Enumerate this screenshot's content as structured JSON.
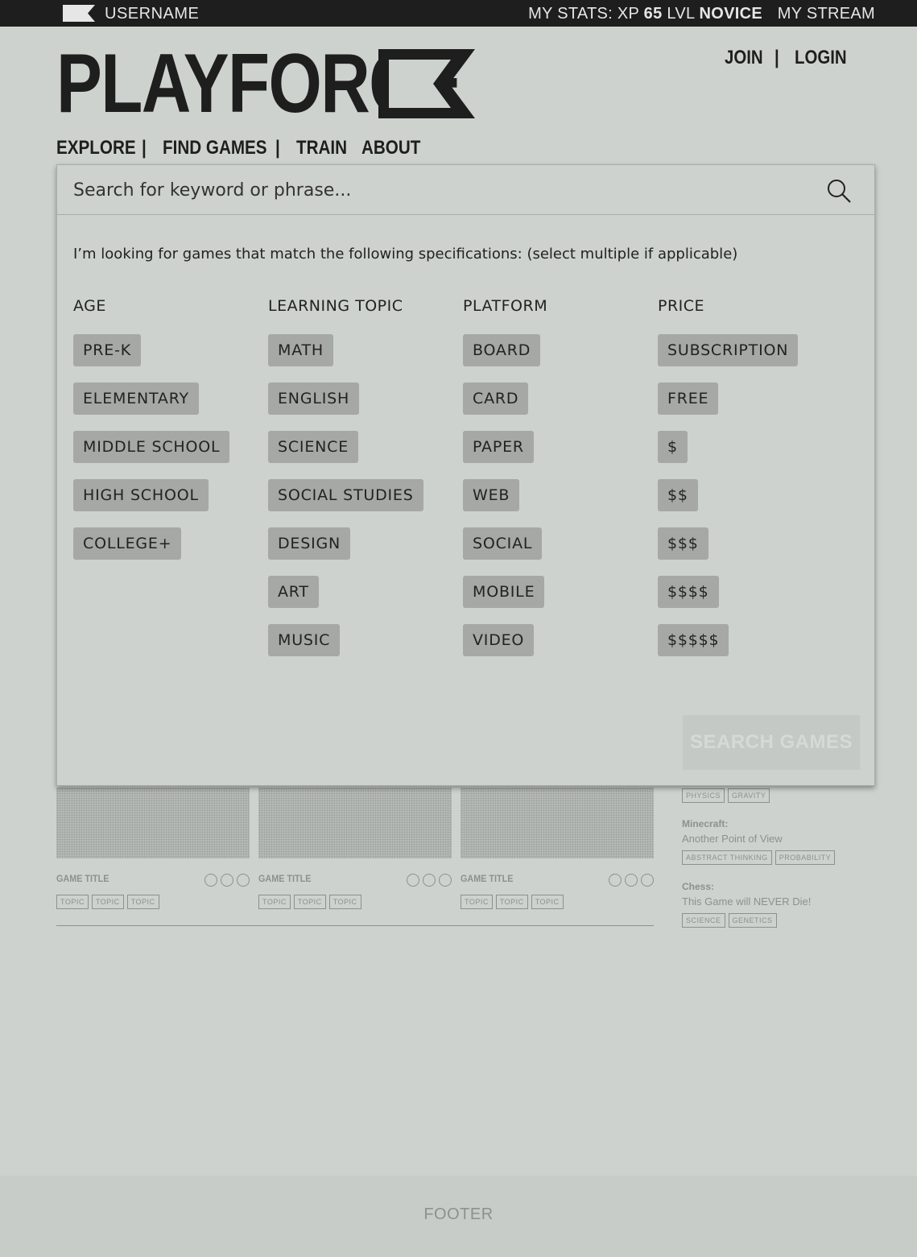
{
  "topbar": {
    "username": "USERNAME",
    "stats_prefix": "MY STATS: XP",
    "xp": "65",
    "lvl_label": "LVL",
    "level": "NOVICE",
    "stream": "MY STREAM"
  },
  "brand": {
    "logo_text": "PLAYFORCE"
  },
  "auth": {
    "join": "JOIN",
    "sep": "|",
    "login": "LOGIN"
  },
  "nav": {
    "explore": "EXPLORE",
    "sep": "|",
    "find_games": "FIND GAMES",
    "train": "TRAIN",
    "about": "ABOUT"
  },
  "search": {
    "placeholder": "Search for keyword or phrase...",
    "intro": "I’m looking for games that match the following specifications: (select multiple if applicable)",
    "submit": "SEARCH GAMES",
    "filters": {
      "age": {
        "heading": "AGE",
        "options": [
          "PRE-K",
          "ELEMENTARY",
          "MIDDLE SCHOOL",
          "HIGH SCHOOL",
          "COLLEGE+"
        ]
      },
      "topic": {
        "heading": "LEARNING TOPIC",
        "options": [
          "MATH",
          "ENGLISH",
          "SCIENCE",
          "SOCIAL STUDIES",
          "DESIGN",
          "ART",
          "MUSIC"
        ]
      },
      "platform": {
        "heading": "PLATFORM",
        "options": [
          "BOARD",
          "CARD",
          "PAPER",
          "WEB",
          "SOCIAL",
          "MOBILE",
          "VIDEO"
        ]
      },
      "price": {
        "heading": "PRICE",
        "options": [
          "SUBSCRIPTION",
          "FREE",
          "$",
          "$$",
          "$$$",
          "$$$$",
          "$$$$$"
        ]
      }
    }
  },
  "games": [
    {
      "title": "GAME TITLE",
      "topics": [
        "TOPIC",
        "TOPIC",
        "TOPIC"
      ]
    },
    {
      "title": "GAME TITLE",
      "topics": [
        "TOPIC",
        "TOPIC",
        "TOPIC"
      ]
    },
    {
      "title": "GAME TITLE",
      "topics": [
        "TOPIC",
        "TOPIC",
        "TOPIC"
      ]
    }
  ],
  "sidebar": {
    "first_tags": [
      "PHYSICS",
      "GRAVITY"
    ],
    "entries": [
      {
        "title": "Minecraft:",
        "desc": "Another Point of View",
        "tags": [
          "ABSTRACT THINKING",
          "PROBABILITY"
        ]
      },
      {
        "title": "Chess:",
        "desc": "This Game will NEVER Die!",
        "tags": [
          "SCIENCE",
          "GENETICS"
        ]
      }
    ]
  },
  "footer": {
    "label": "FOOTER"
  },
  "colors": {
    "topbar": "#1e1e1e",
    "background": "#cdd2ce",
    "chip": "#a5a8a5",
    "muted": "#8d918e"
  }
}
